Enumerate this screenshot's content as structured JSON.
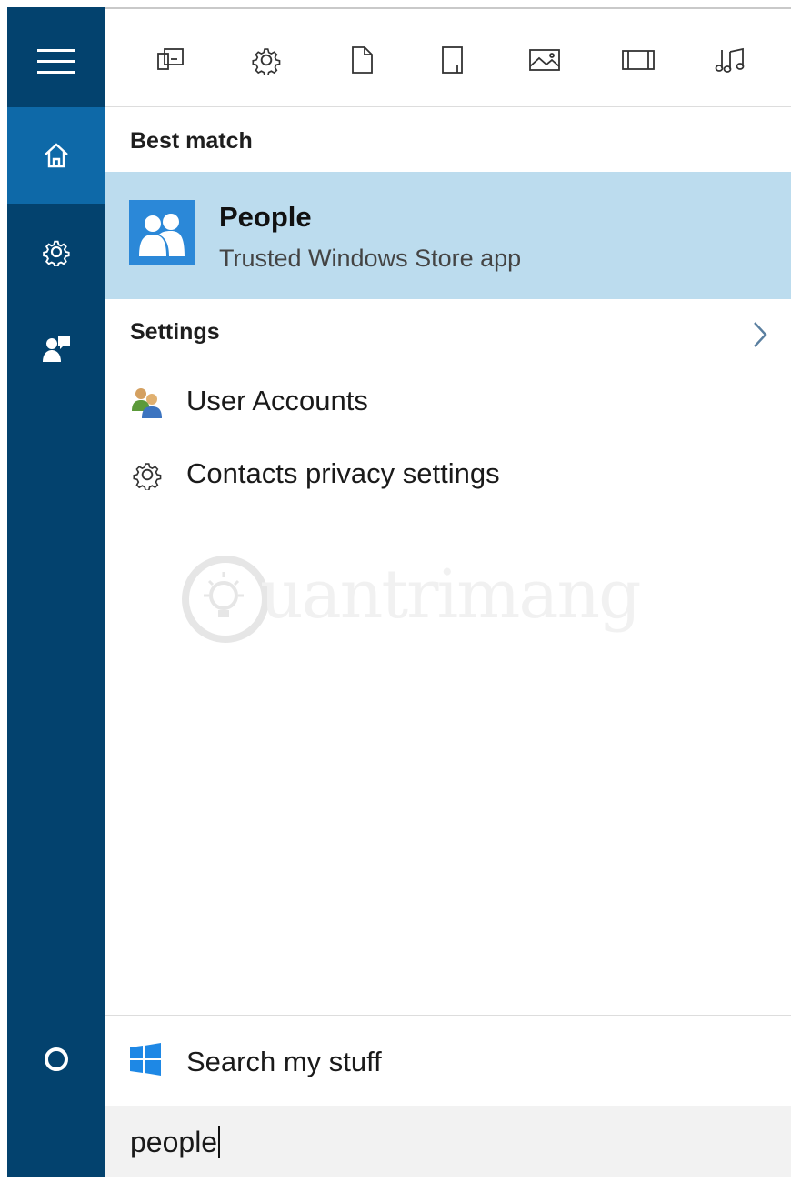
{
  "filters": [
    {
      "icon": "apps-filter-icon"
    },
    {
      "icon": "settings-filter-icon"
    },
    {
      "icon": "documents-filter-icon"
    },
    {
      "icon": "folders-filter-icon"
    },
    {
      "icon": "photos-filter-icon"
    },
    {
      "icon": "videos-filter-icon"
    },
    {
      "icon": "music-filter-icon"
    }
  ],
  "sidebar": {
    "items": [
      {
        "icon": "hamburger-menu-icon"
      },
      {
        "icon": "home-icon",
        "active": true
      },
      {
        "icon": "gear-icon"
      },
      {
        "icon": "feedback-icon"
      },
      {
        "icon": "cortana-circle-icon"
      }
    ]
  },
  "best_match": {
    "heading": "Best match",
    "title": "People",
    "subtitle": "Trusted Windows Store app",
    "icon": "people-app-icon"
  },
  "settings": {
    "heading": "Settings",
    "items": [
      {
        "label": "User Accounts",
        "icon": "user-accounts-icon"
      },
      {
        "label": "Contacts privacy settings",
        "icon": "gear-icon"
      }
    ]
  },
  "watermark": {
    "text": "uantrimang"
  },
  "search_my_stuff": {
    "label": "Search my stuff",
    "icon": "windows-logo-icon"
  },
  "search": {
    "query": "people"
  },
  "colors": {
    "sidebar": "#03426e",
    "sidebar_active": "#0e69a8",
    "highlight": "#bcdcee",
    "accent": "#2b88d8"
  }
}
